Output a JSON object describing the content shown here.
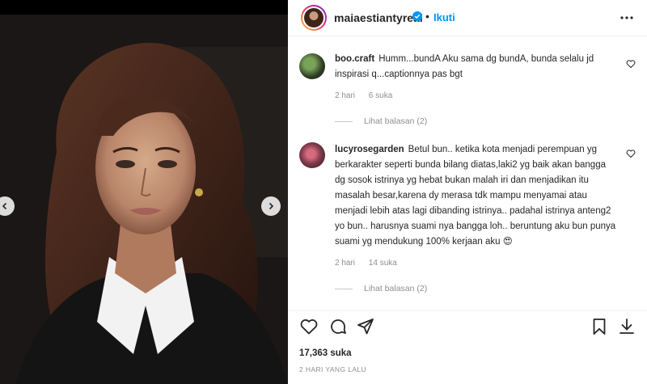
{
  "post": {
    "username": "maiaestiantyreal",
    "follow_label": "Ikuti",
    "likes": "17,363 suka",
    "timestamp": "2 HARI YANG LALU"
  },
  "comments": [
    {
      "username": "boo.craft",
      "text": "Humm...bundA Aku sama dg bundA, bunda selalu jd inspirasi q...captionnya pas bgt",
      "time": "2 hari",
      "likes": "6 suka",
      "replies": "Lihat balasan (2)"
    },
    {
      "username": "lucyrosegarden",
      "text": "Betul bun.. ketika kota menjadi perempuan yg berkarakter seperti bunda bilang diatas,laki2 yg baik akan bangga dg sosok istrinya yg hebat bukan malah iri dan menjadikan itu masalah besar,karena dy merasa tdk mampu menyamai atau menjadi lebih atas lagi dibanding istrinya.. padahal istrinya anteng2 yo bun.. harusnya suami nya bangga loh.. beruntung aku bun punya suami yg mendukung 100% kerjaan aku",
      "emoji": "😍",
      "time": "2 hari",
      "likes": "14 suka",
      "replies": "Lihat balasan (2)"
    }
  ],
  "icons": {
    "verified": "verified-badge-icon",
    "more": "more-options-icon",
    "like": "heart-icon",
    "comment": "comment-icon",
    "share": "share-icon",
    "save": "bookmark-icon",
    "download": "download-icon",
    "prev": "chevron-left-icon",
    "next": "chevron-right-icon"
  },
  "colors": {
    "accent": "#0095f6",
    "text": "#262626",
    "muted": "#8e8e8e",
    "like_red": "#ed4956"
  }
}
